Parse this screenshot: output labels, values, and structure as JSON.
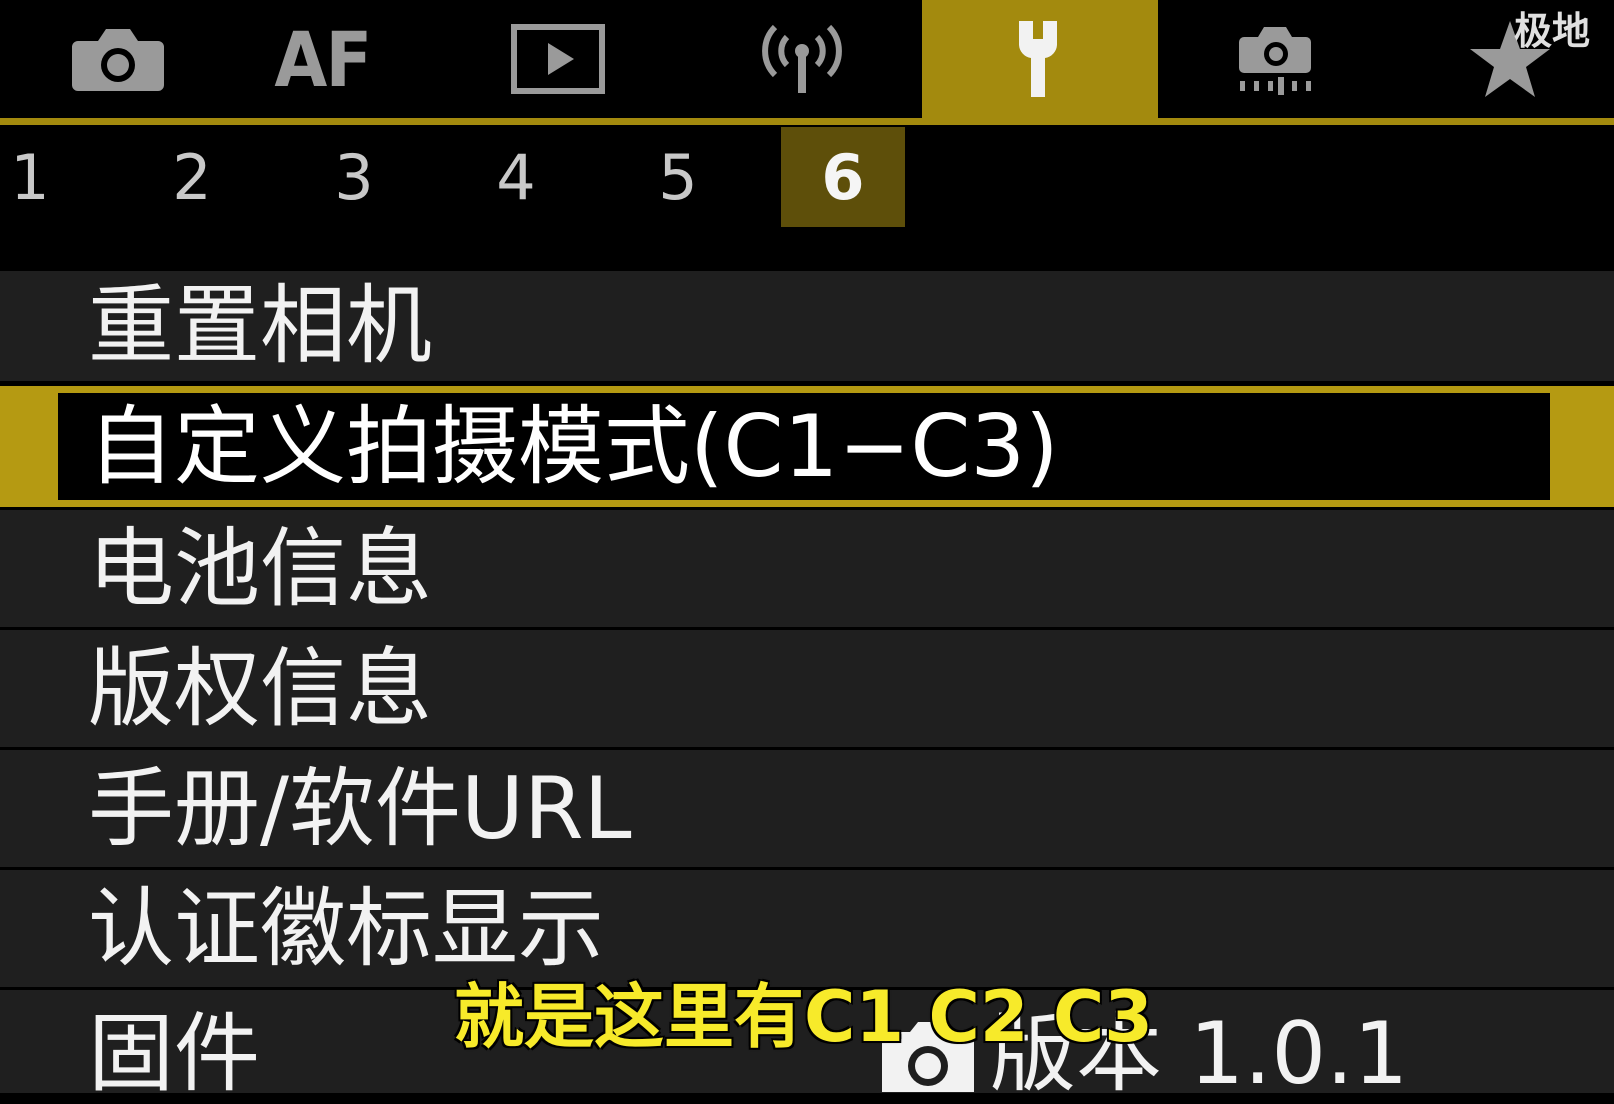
{
  "category_tabs": [
    {
      "name": "shooting",
      "icon": "camera-icon",
      "label": ""
    },
    {
      "name": "af",
      "icon": "",
      "label": "AF"
    },
    {
      "name": "playback",
      "icon": "playback-icon",
      "label": ""
    },
    {
      "name": "wireless",
      "icon": "wireless-icon",
      "label": ""
    },
    {
      "name": "setup",
      "icon": "wrench-icon",
      "label": "",
      "active": true
    },
    {
      "name": "custom-functions",
      "icon": "camera-custom-icon",
      "label": ""
    },
    {
      "name": "my-menu",
      "icon": "star-icon",
      "label": ""
    }
  ],
  "pages": [
    "1",
    "2",
    "3",
    "4",
    "5",
    "6"
  ],
  "active_page": "6",
  "menu": {
    "items": [
      {
        "label": "重置相机"
      },
      {
        "label": "自定义拍摄模式(C1−C3)",
        "selected": true
      },
      {
        "label": "电池信息"
      },
      {
        "label": "版权信息"
      },
      {
        "label": "手册/软件URL"
      },
      {
        "label": "认证徽标显示"
      },
      {
        "label": "固件",
        "value_icon": "camera-body-icon",
        "value": "版本 1.0.1"
      }
    ]
  },
  "overlay": {
    "watermark": "极地",
    "subtitle": "就是这里有C1 C2 C3"
  },
  "colors": {
    "accent": "#a38a0e",
    "selection_border": "#b59a12",
    "active_page_bg": "#5e4f0a",
    "row_bg": "#1f1f1f",
    "subtitle": "#f7ea2a"
  }
}
